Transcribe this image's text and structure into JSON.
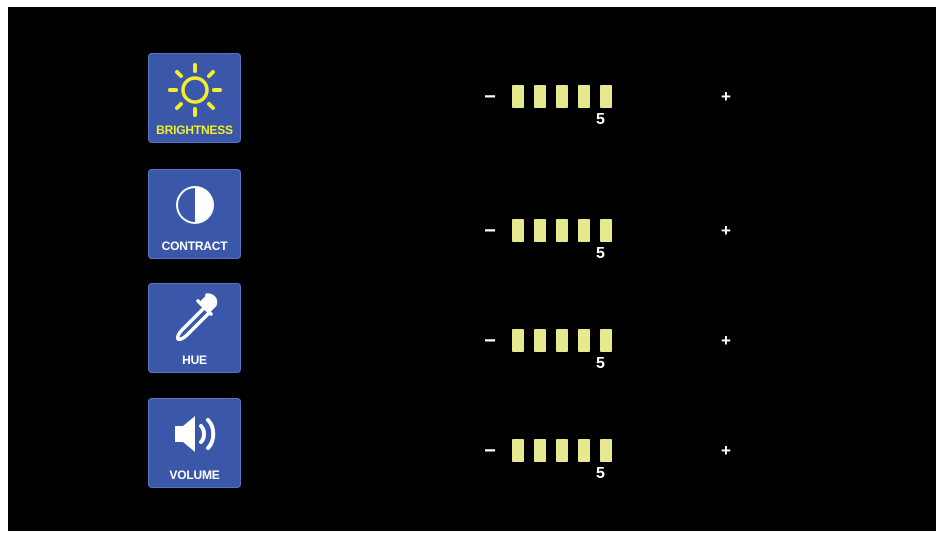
{
  "colors": {
    "tile_background": "#3a57a9",
    "level_bar": "#e6e98d",
    "brightness_accent": "#f2ee2c",
    "background": "#000000"
  },
  "settings": [
    {
      "key": "brightness",
      "label": "BRIGHTNESS",
      "icon": "sun-icon",
      "minus_label": "−",
      "plus_label": "+",
      "level": 5,
      "level_text": "5"
    },
    {
      "key": "contrast",
      "label": "CONTRACT",
      "icon": "contrast-icon",
      "minus_label": "−",
      "plus_label": "+",
      "level": 5,
      "level_text": "5"
    },
    {
      "key": "hue",
      "label": "HUE",
      "icon": "eyedropper-icon",
      "minus_label": "−",
      "plus_label": "+",
      "level": 5,
      "level_text": "5"
    },
    {
      "key": "volume",
      "label": "VOLUME",
      "icon": "speaker-icon",
      "minus_label": "−",
      "plus_label": "+",
      "level": 5,
      "level_text": "5"
    }
  ]
}
